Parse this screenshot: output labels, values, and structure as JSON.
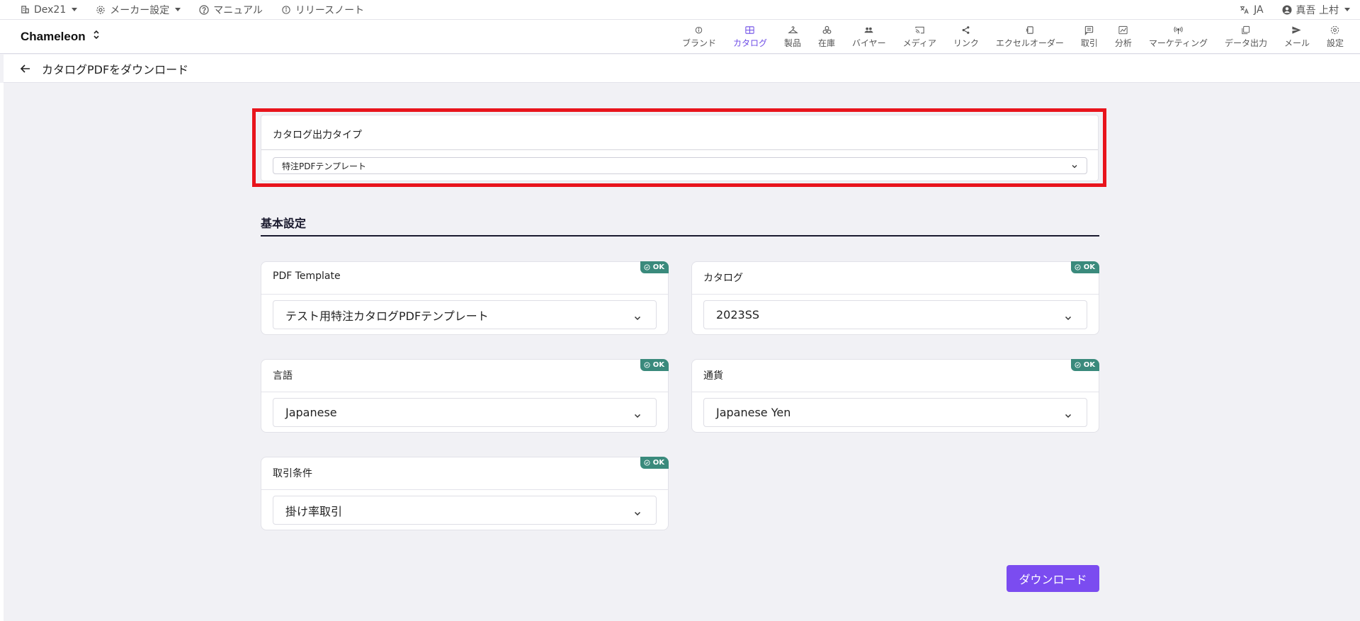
{
  "topbar": {
    "company": "Dex21",
    "maker_settings": "メーカー設定",
    "manual": "マニュアル",
    "release_notes": "リリースノート",
    "language": "JA",
    "user": "真吾 上村"
  },
  "navbar": {
    "brand": "Chameleon",
    "items": [
      {
        "label": "ブランド",
        "icon": "info-icon"
      },
      {
        "label": "カタログ",
        "icon": "catalog-grid-icon",
        "active": true
      },
      {
        "label": "製品",
        "icon": "hanger-icon"
      },
      {
        "label": "在庫",
        "icon": "boxes-icon"
      },
      {
        "label": "バイヤー",
        "icon": "people-icon"
      },
      {
        "label": "メディア",
        "icon": "cast-icon"
      },
      {
        "label": "リンク",
        "icon": "share-icon"
      },
      {
        "label": "エクセルオーダー",
        "icon": "excel-icon"
      },
      {
        "label": "取引",
        "icon": "message-icon"
      },
      {
        "label": "分析",
        "icon": "chart-icon"
      },
      {
        "label": "マーケティング",
        "icon": "broadcast-icon"
      },
      {
        "label": "データ出力",
        "icon": "copy-icon"
      },
      {
        "label": "メール",
        "icon": "send-icon"
      },
      {
        "label": "設定",
        "icon": "gear-icon"
      }
    ],
    "active_color": "#6d4ce6"
  },
  "subheader": {
    "title": "カタログPDFをダウンロード"
  },
  "output_type": {
    "label": "カタログ出力タイプ",
    "value": "特注PDFテンプレート"
  },
  "basic_settings": {
    "title": "基本設定",
    "fields": [
      {
        "label": "PDF Template",
        "value": "テスト用特注カタログPDFテンプレート",
        "status": "OK"
      },
      {
        "label": "カタログ",
        "value": "2023SS",
        "status": "OK"
      },
      {
        "label": "言語",
        "value": "Japanese",
        "status": "OK"
      },
      {
        "label": "通貨",
        "value": "Japanese Yen",
        "status": "OK"
      },
      {
        "label": "取引条件",
        "value": "掛け率取引",
        "status": "OK"
      }
    ]
  },
  "download_button": "ダウンロード",
  "colors": {
    "accent": "#7b4cf0",
    "ok_badge": "#3a8a7c",
    "highlight": "#e8141c"
  }
}
